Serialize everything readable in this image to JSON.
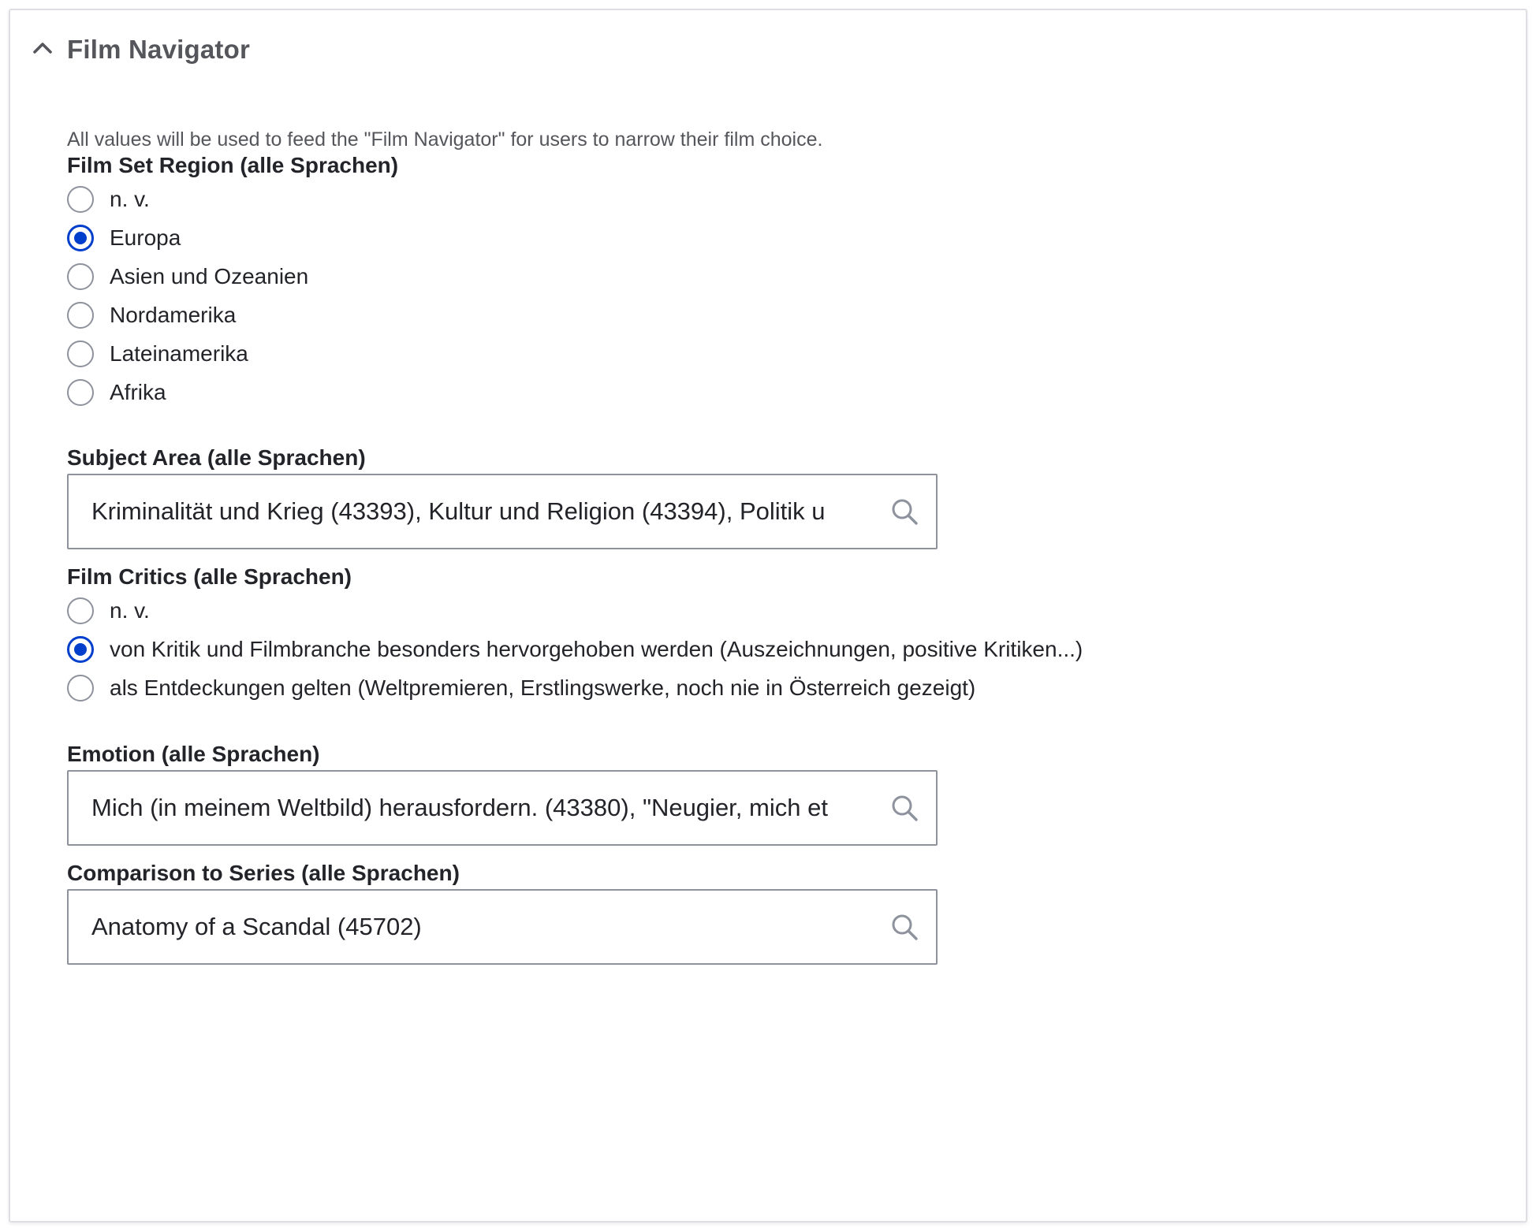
{
  "panel": {
    "title": "Film Navigator",
    "expanded": true,
    "description": "All values will be used to feed the \"Film Navigator\" for users to narrow their film choice."
  },
  "film_set_region": {
    "label": "Film Set Region (alle Sprachen)",
    "selected": "Europa",
    "options": [
      {
        "label": "n. v.",
        "checked": false
      },
      {
        "label": "Europa",
        "checked": true
      },
      {
        "label": "Asien und Ozeanien",
        "checked": false
      },
      {
        "label": "Nordamerika",
        "checked": false
      },
      {
        "label": "Lateinamerika",
        "checked": false
      },
      {
        "label": "Afrika",
        "checked": false
      }
    ]
  },
  "subject_area": {
    "label": "Subject Area (alle Sprachen)",
    "value": "Kriminalität und Krieg (43393), Kultur und Religion (43394), Politik u"
  },
  "film_critics": {
    "label": "Film Critics (alle Sprachen)",
    "selected": "von Kritik und Filmbranche besonders hervorgehoben werden (Auszeichnungen, positive Kritiken...)",
    "options": [
      {
        "label": "n. v.",
        "checked": false
      },
      {
        "label": "von Kritik und Filmbranche besonders hervorgehoben werden (Auszeichnungen, positive Kritiken...)",
        "checked": true
      },
      {
        "label": "als Entdeckungen gelten (Weltpremieren, Erstlingswerke, noch nie in Österreich gezeigt)",
        "checked": false
      }
    ]
  },
  "emotion": {
    "label": "Emotion (alle Sprachen)",
    "value": "Mich (in meinem Weltbild) herausfordern. (43380), \"Neugier, mich et"
  },
  "comparison_to_series": {
    "label": "Comparison to Series (alle Sprachen)",
    "value": "Anatomy of a Scandal (45702)"
  },
  "icons": {
    "toggle": "chevron-up-icon",
    "search": "search-icon"
  },
  "colors": {
    "accent": "#003ecc",
    "text": "#232429",
    "muted_text": "#55565b",
    "border": "#8e929c",
    "panel_border": "#dedfe4"
  }
}
